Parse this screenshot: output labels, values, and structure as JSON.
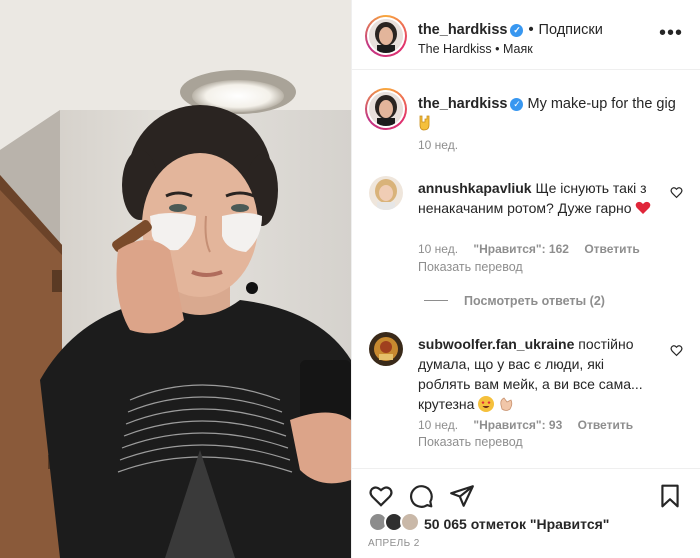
{
  "header": {
    "username": "the_hardkiss",
    "follow_label": "Подписки",
    "subtitle": "The Hardkiss • Маяк",
    "more_label": "•••"
  },
  "caption": {
    "username": "the_hardkiss",
    "text": "My make-up for the gig",
    "time": "10 нед."
  },
  "comments": [
    {
      "username": "annushkapavliuk",
      "text": "Ще існують такі з ненакачаним ротом? Дуже гарно",
      "time": "10 нед.",
      "likes": "\"Нравится\": 162",
      "reply_label": "Ответить",
      "translate_label": "Показать перевод",
      "view_replies": "Посмотреть ответы (2)"
    },
    {
      "username": "subwoolfer.fan_ukraine",
      "text": "постійно думала, що у вас є люди, які роблять вам мейк, а ви все сама... крутезна",
      "time": "10 нед.",
      "likes": "\"Нравится\": 93",
      "reply_label": "Ответить",
      "translate_label": "Показать перевод"
    }
  ],
  "footer": {
    "likes_text": "50 065 отметок \"Нравится\"",
    "date": "АПРЕЛЬ 2"
  },
  "icons": {
    "like": "heart-icon",
    "comment": "comment-icon",
    "share": "send-icon",
    "save": "bookmark-icon",
    "verified": "verified-badge-icon"
  },
  "colors": {
    "verified": "#3897f0",
    "secondary_text": "#8e8e8e",
    "heart_red": "#ed4956"
  }
}
